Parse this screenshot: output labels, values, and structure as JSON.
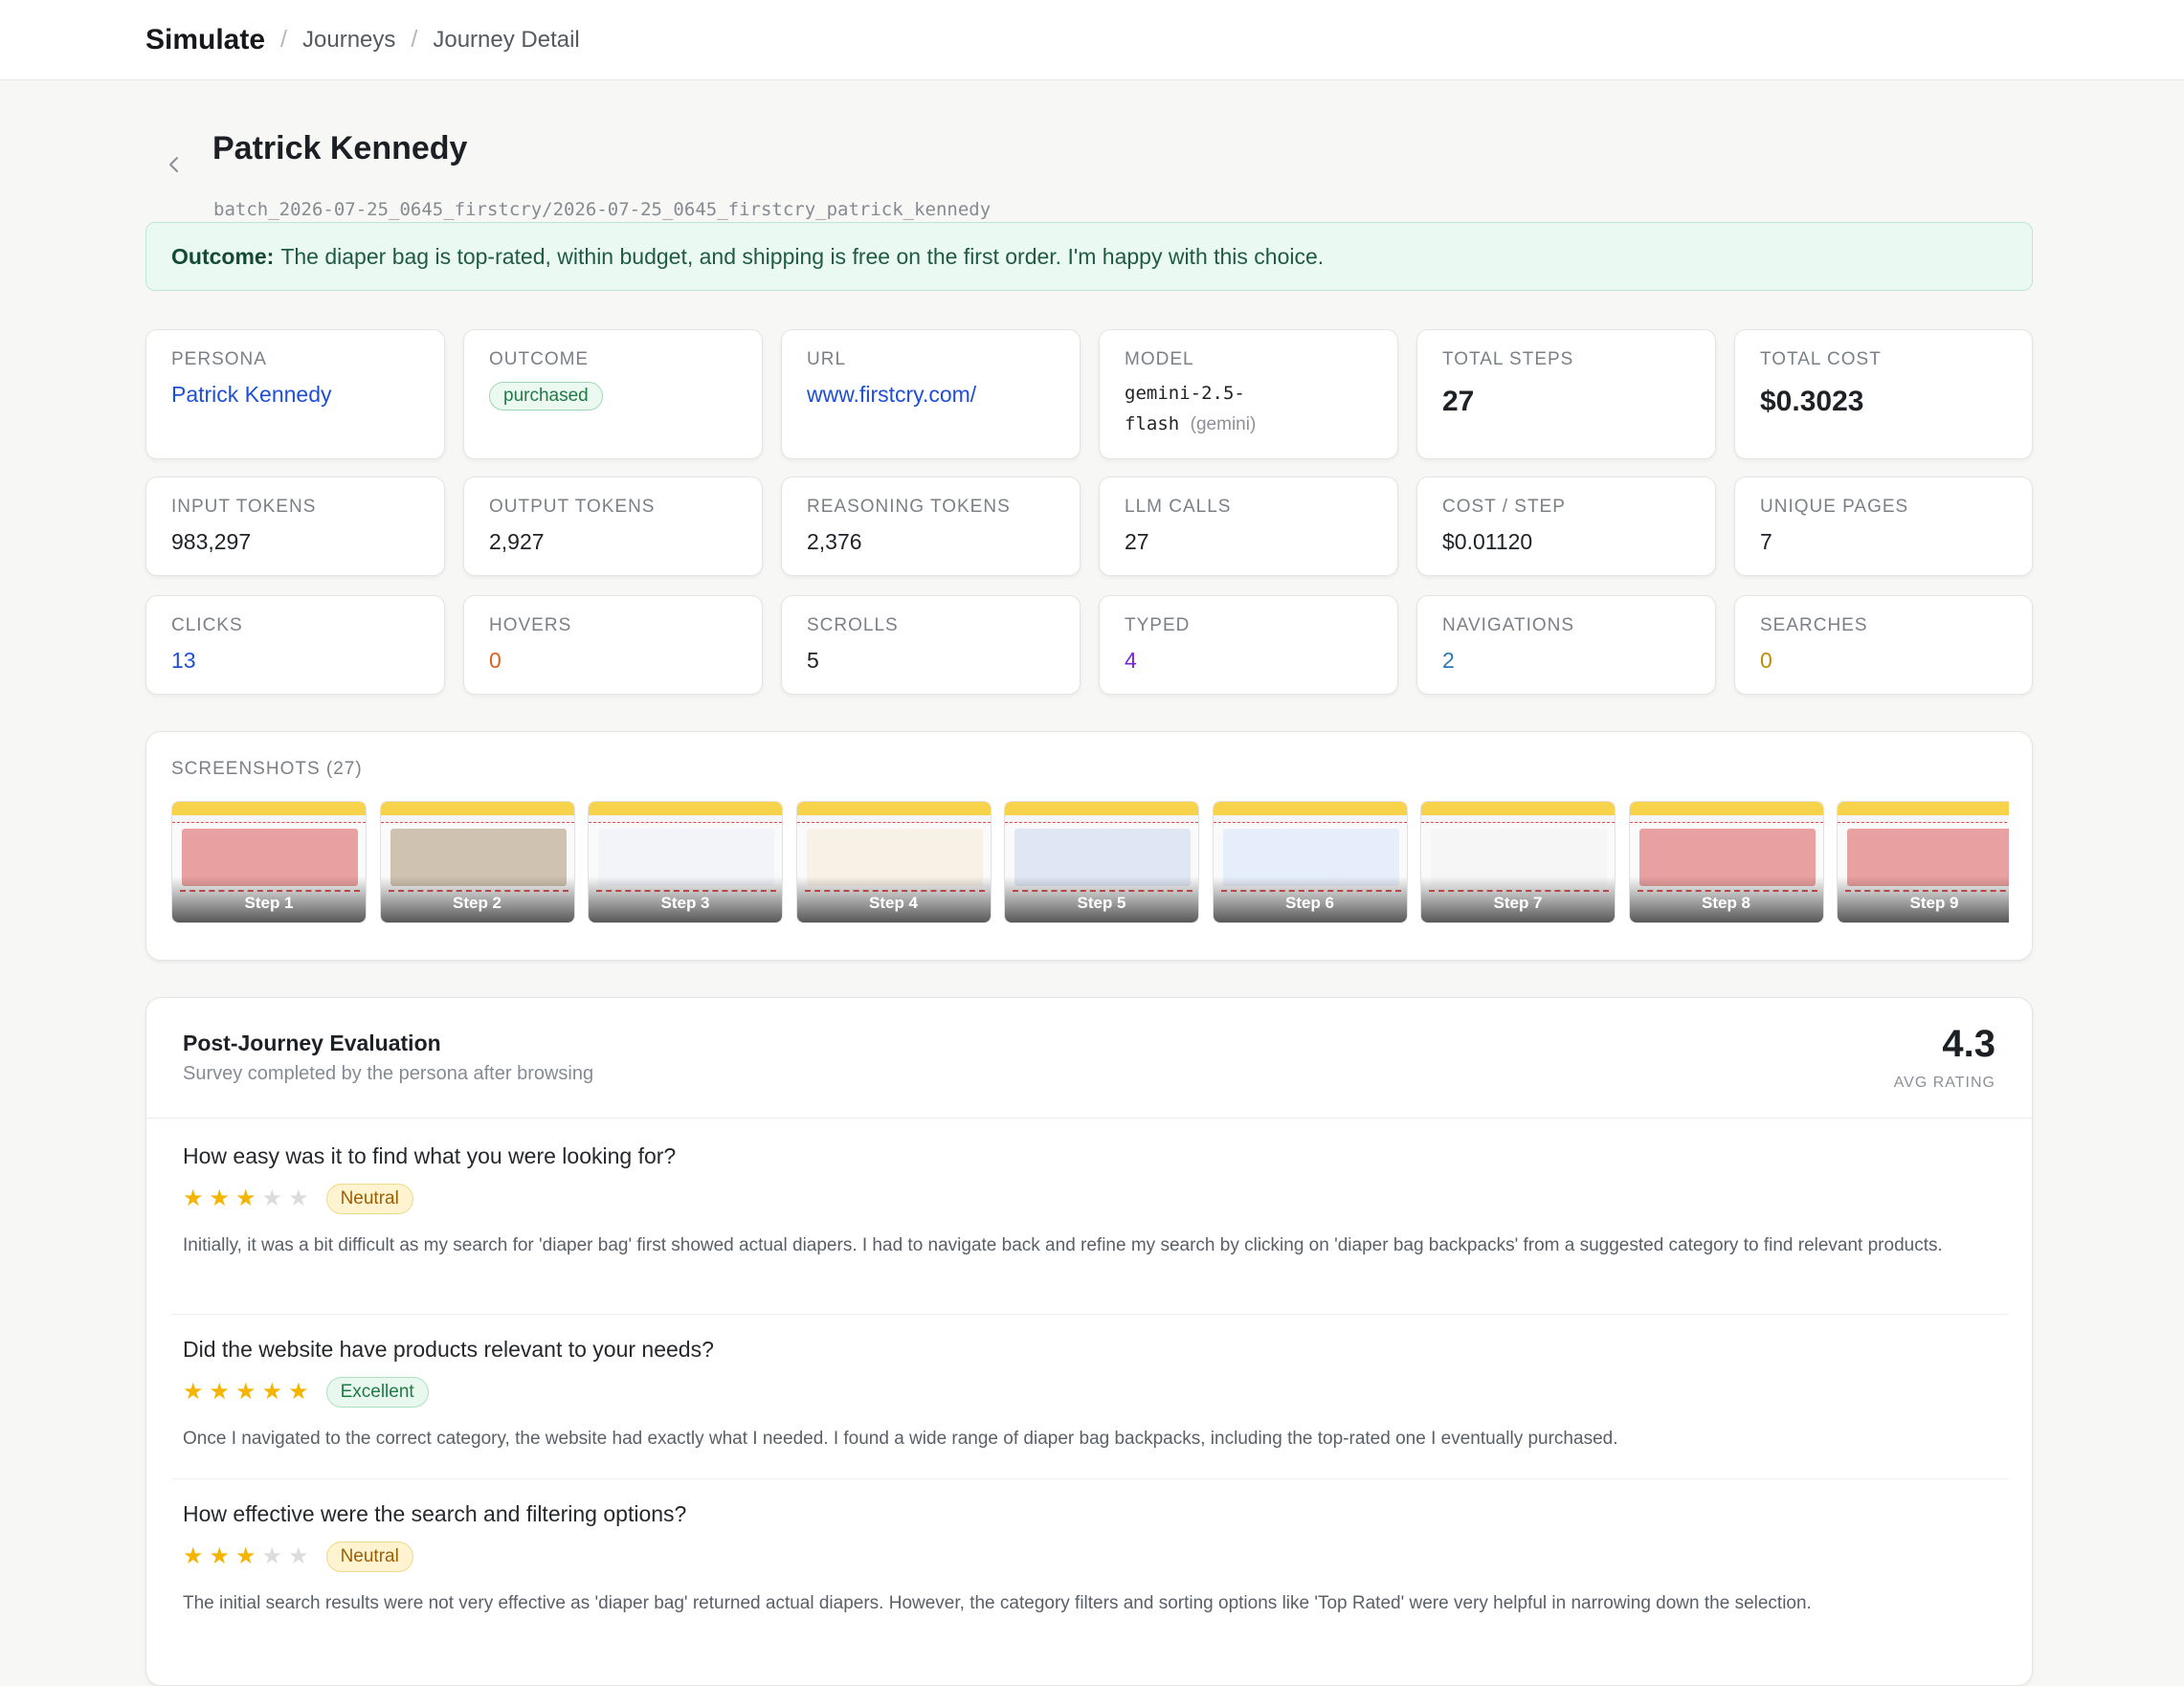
{
  "nav": {
    "brand": "Simulate",
    "breadcrumbs": [
      "Journeys",
      "Journey Detail"
    ]
  },
  "header": {
    "title": "Patrick Kennedy",
    "path": "batch_2026-07-25_0645_firstcry/2026-07-25_0645_firstcry_patrick_kennedy"
  },
  "outcome_banner": {
    "label": "Outcome:",
    "text": "The diaper bag is top-rated, within budget, and shipping is free on the first order. I'm happy with this choice."
  },
  "stats_row1": {
    "persona": {
      "label": "PERSONA",
      "value": "Patrick Kennedy"
    },
    "outcome": {
      "label": "OUTCOME",
      "value": "purchased"
    },
    "url": {
      "label": "URL",
      "value": "www.firstcry.com/"
    },
    "model": {
      "label": "MODEL",
      "line1": "gemini-2.5-",
      "line2": "flash",
      "provider": "(gemini)"
    },
    "total_steps": {
      "label": "TOTAL STEPS",
      "value": "27"
    },
    "total_cost": {
      "label": "TOTAL COST",
      "value": "$0.3023"
    }
  },
  "stats_row2": [
    {
      "label": "INPUT TOKENS",
      "value": "983,297"
    },
    {
      "label": "OUTPUT TOKENS",
      "value": "2,927"
    },
    {
      "label": "REASONING TOKENS",
      "value": "2,376"
    },
    {
      "label": "LLM CALLS",
      "value": "27"
    },
    {
      "label": "COST / STEP",
      "value": "$0.01120"
    },
    {
      "label": "UNIQUE PAGES",
      "value": "7"
    }
  ],
  "stats_row3": [
    {
      "label": "CLICKS",
      "value": "13"
    },
    {
      "label": "HOVERS",
      "value": "0"
    },
    {
      "label": "SCROLLS",
      "value": "5"
    },
    {
      "label": "TYPED",
      "value": "4"
    },
    {
      "label": "NAVIGATIONS",
      "value": "2"
    },
    {
      "label": "SEARCHES",
      "value": "0"
    }
  ],
  "colors": {
    "clicks": "#1f4fd6",
    "hovers": "#e0601c",
    "typed": "#7a24d9",
    "navigations": "#2a78b4",
    "searches": "#c28a06"
  },
  "screenshots": {
    "title": "SCREENSHOTS (27)",
    "items": [
      "Step 1",
      "Step 2",
      "Step 3",
      "Step 4",
      "Step 5",
      "Step 6",
      "Step 7",
      "Step 8",
      "Step 9"
    ]
  },
  "evaluation": {
    "title": "Post-Journey Evaluation",
    "subtitle": "Survey completed by the persona after browsing",
    "avg_value": "4.3",
    "avg_label": "AVG RATING",
    "questions": [
      {
        "question": "How easy was it to find what you were looking for?",
        "rating": 3,
        "tag": "Neutral",
        "answer": "Initially, it was a bit difficult as my search for 'diaper bag' first showed actual diapers. I had to navigate back and refine my search by clicking on 'diaper bag backpacks' from a suggested category to find relevant products."
      },
      {
        "question": "Did the website have products relevant to your needs?",
        "rating": 5,
        "tag": "Excellent",
        "answer": "Once I navigated to the correct category, the website had exactly what I needed. I found a wide range of diaper bag backpacks, including the top-rated one I eventually purchased."
      },
      {
        "question": "How effective were the search and filtering options?",
        "rating": 3,
        "tag": "Neutral",
        "answer": "The initial search results were not very effective as 'diaper bag' returned actual diapers. However, the category filters and sorting options like 'Top Rated' were very helpful in narrowing down the selection."
      }
    ]
  }
}
